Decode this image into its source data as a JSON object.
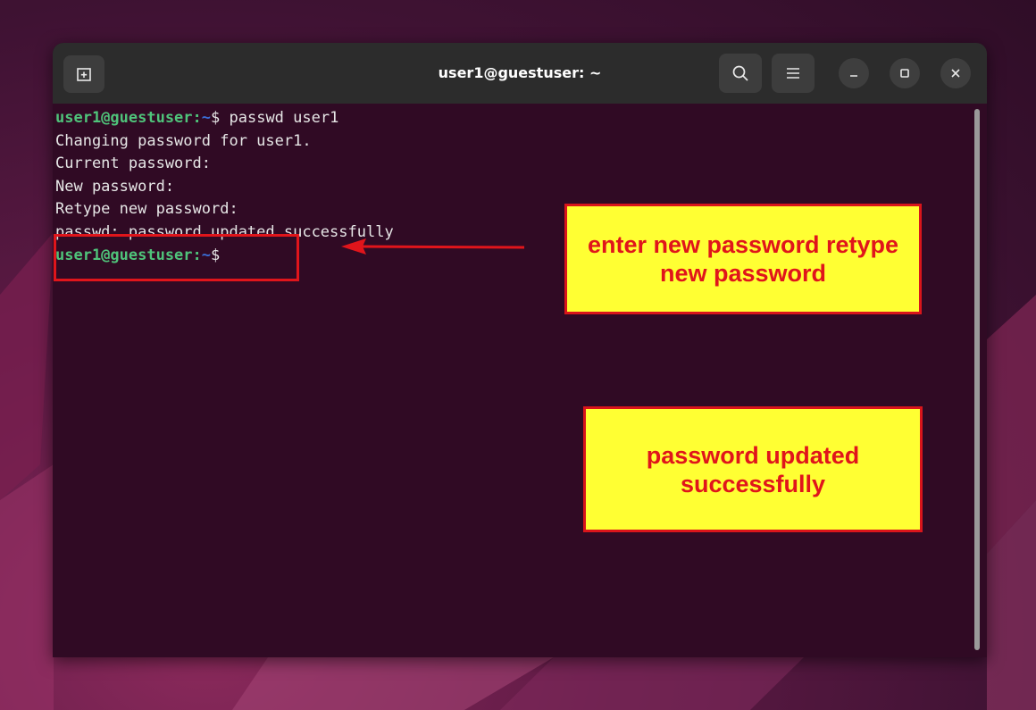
{
  "window": {
    "title": "user1@guestuser: ~"
  },
  "icons": {
    "new_tab": "new-tab-icon",
    "search": "search-icon",
    "menu": "hamburger-menu-icon",
    "minimize": "minimize-icon",
    "maximize": "maximize-icon",
    "close": "close-icon"
  },
  "terminal": {
    "lines": [
      {
        "user": "user1@guestuser",
        "sep": ":",
        "path": "~",
        "rest": "$ passwd user1"
      },
      {
        "text": "Changing password for user1."
      },
      {
        "text": "Current password:"
      },
      {
        "text": "New password:"
      },
      {
        "text": "Retype new password:"
      },
      {
        "text": "passwd: password updated successfully"
      },
      {
        "user": "user1@guestuser",
        "sep": ":",
        "path": "~",
        "rest": "$"
      }
    ]
  },
  "annotations": {
    "callout_new_password": "enter new password retype new password",
    "callout_updated": "password updated successfully"
  },
  "colors": {
    "terminal_bg": "#300a24",
    "prompt_user": "#4fc37a",
    "prompt_path": "#3a6fd8",
    "callout_fill": "#ffff33",
    "callout_text": "#e0151b"
  }
}
